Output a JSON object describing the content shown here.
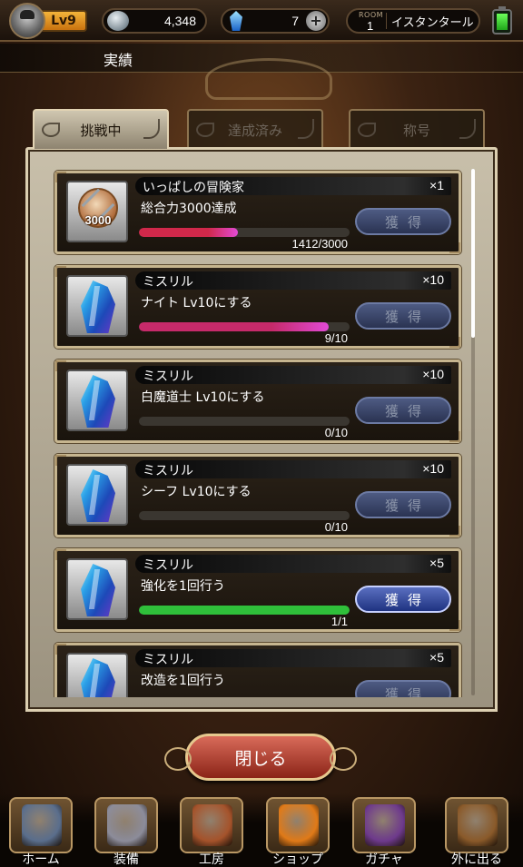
{
  "status_bar": {
    "level": "Lv9",
    "gil": "4,348",
    "crystals": "7",
    "add_symbol": "+",
    "room_label": "ROOM",
    "room_number": "1",
    "room_name": "イスタンタール",
    "icons": [
      "player-avatar-icon",
      "gil-coin-icon",
      "crystal-icon",
      "add-icon",
      "battery-icon"
    ]
  },
  "header": {
    "title": "実績"
  },
  "tabs": [
    {
      "label": "挑戦中",
      "active": true
    },
    {
      "label": "達成済み",
      "active": false
    },
    {
      "label": "称号",
      "active": false
    }
  ],
  "achievements": [
    {
      "reward_name": "いっぱしの冒険家",
      "quantity": "×1",
      "description": "総合力3000達成",
      "progress_text": "1412/3000",
      "progress": 0.47,
      "claim_label": "獲得",
      "claimable": false,
      "icon": "medal-icon",
      "icon_text": "3000",
      "bar_color": "#d0284a"
    },
    {
      "reward_name": "ミスリル",
      "quantity": "×10",
      "description": "ナイト Lv10にする",
      "progress_text": "9/10",
      "progress": 0.9,
      "claim_label": "獲得",
      "claimable": false,
      "icon": "mithril-crystal-icon",
      "bar_color": "#c62a6a"
    },
    {
      "reward_name": "ミスリル",
      "quantity": "×10",
      "description": "白魔道士 Lv10にする",
      "progress_text": "0/10",
      "progress": 0,
      "claim_label": "獲得",
      "claimable": false,
      "icon": "mithril-crystal-icon",
      "bar_color": "#d0284a"
    },
    {
      "reward_name": "ミスリル",
      "quantity": "×10",
      "description": "シーフ Lv10にする",
      "progress_text": "0/10",
      "progress": 0,
      "claim_label": "獲得",
      "claimable": false,
      "icon": "mithril-crystal-icon",
      "bar_color": "#d0284a"
    },
    {
      "reward_name": "ミスリル",
      "quantity": "×5",
      "description": "強化を1回行う",
      "progress_text": "1/1",
      "progress": 1,
      "claim_label": "獲得",
      "claimable": true,
      "icon": "mithril-crystal-icon",
      "bar_color": "#2fbf3a"
    },
    {
      "reward_name": "ミスリル",
      "quantity": "×5",
      "description": "改造を1回行う",
      "progress_text": "",
      "progress": 0,
      "claim_label": "獲得",
      "claimable": false,
      "icon": "mithril-crystal-icon",
      "bar_color": "#d0284a"
    }
  ],
  "close_label": "閉じる",
  "bottom_nav": [
    {
      "label": "ホーム",
      "icon": "home-tent-icon",
      "color": "#5a6e8c"
    },
    {
      "label": "装備",
      "icon": "equipment-sword-icon",
      "color": "#8c8c9a"
    },
    {
      "label": "工房",
      "icon": "workshop-anvil-icon",
      "color": "#a5532b"
    },
    {
      "label": "ショップ",
      "icon": "shop-icon",
      "color": "#e07a18"
    },
    {
      "label": "ガチャ",
      "icon": "gacha-weapons-icon",
      "color": "#6e3a8c"
    },
    {
      "label": "外に出る",
      "icon": "exit-door-icon",
      "color": "#8a5a2a"
    }
  ]
}
